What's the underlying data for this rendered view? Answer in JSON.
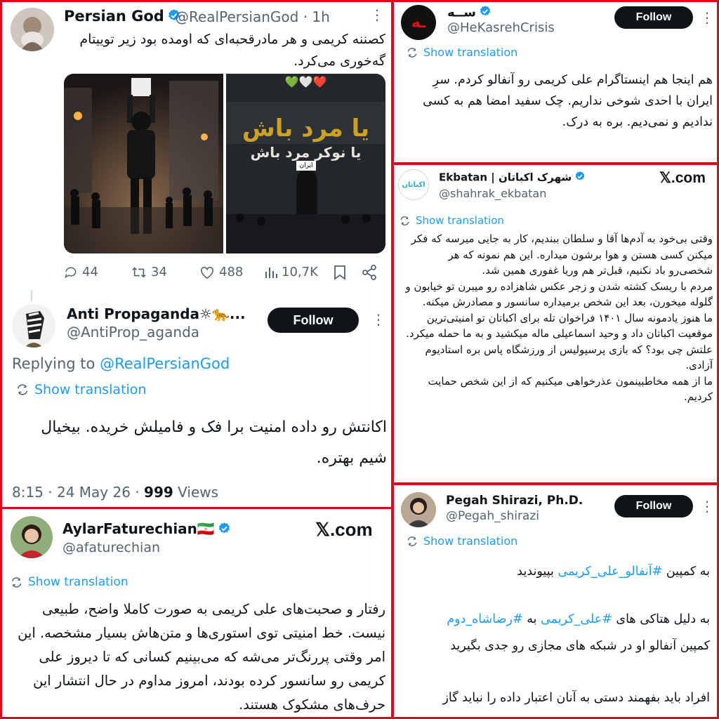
{
  "tweet1": {
    "display_name": "Persian God",
    "handle": "@RealPersianGod",
    "time": "· 1h",
    "text": "کصننه کریمی و هر مادرقحبه‌ای که اومده بود زیر توییتام گه‌خوری می‌کرد.",
    "media2": {
      "emojis": "💚🤍❤️",
      "line1": "یا مرد باش",
      "line2": "یا نوکر مرد باش",
      "sign": "ایران"
    },
    "stats": {
      "replies": "44",
      "retweets": "34",
      "likes": "488",
      "views": "10,7K"
    }
  },
  "reply": {
    "display_name": "Anti Propaganda☼🐆...",
    "handle": "@AntiProp_aganda",
    "follow": "Follow",
    "replying_prefix": "Replying to",
    "replying_to": "@RealPersianGod",
    "show_translation": "Show translation",
    "text": "اکانتش رو داده امنیت برا فک و فامیلش خریده. بیخیال شیم بهتره.",
    "meta_prefix": "8:15 · 24 May 26 ·",
    "views_count": "999",
    "views_label": "Views"
  },
  "tweet2": {
    "display_name": "ســه",
    "avatar_text": "ـه",
    "handle": "@HeKasrehCrisis",
    "follow": "Follow",
    "show_translation": "Show translation",
    "text": "هم اینجا هم اینستاگرام علی کریمی رو آنفالو کردم. سرِ ایران با احدی شوخی نداریم. چک سفید امضا هم به کسی ندادیم و نمی‌دیم. بره به درک."
  },
  "tweet3": {
    "display_name": "Ekbatan | شهرک اکباتان",
    "handle": "@shahrak_ekbatan",
    "avatar_text": "اکباتان",
    "xcom": "𝕏.com",
    "show_translation": "Show translation",
    "paragraphs": [
      "وقتی بی‌خود به آدم‌ها آقا و سلطان ببندیم، کار به جایی میرسه که فکر میکنن کسی هستن و هوا برشون میداره. این هم نمونه که هر شخصی‌رو باد نکنیم، قبل‌تر هم وریا غفوری همین شد.",
      "مردم با ریسک کشته شدن و زجر عکس شاهزاده رو میبرن تو خیابون و گلوله میخورن، بعد این شخص برمیداره سانسور و مصادرش میکنه.",
      "ما هنوز یادمونه سال ۱۴۰۱ فراخوان تله برای اکباتان تو امنیتی‌ترین موقعیت اکباتان داد و وحید اسماعیلی ماله میکشید و به ما حمله میکرد. علتش چی بود؟ که بازی پرسپولیس از ورزشگاه پاس بره استادیوم آزادی.",
      "ما از همه مخاطبینمون عذرخواهی میکنیم که از این شخص حمایت کردیم."
    ]
  },
  "tweet4": {
    "display_name": "AylarFaturechian🇮🇷",
    "handle": "@afaturechian",
    "xcom": "𝕏.com",
    "show_translation": "Show translation",
    "text": "رفتار و صحبت‌های علی کریمی به صورت کاملا واضح، طبیعی نیست. خط امنیتی توی استوری‌ها و متن‌هاش بسیار مشخصه. این امر وقتی پررنگ‌تر می‌شه که می‌بینیم کسانی که تا دیروز علی کریمی رو سانسور کرده بودند، امروز مداوم در حال انتشار این حرف‌های مشکوک هستند."
  },
  "tweet5": {
    "display_name": "Pegah Shirazi, Ph.D.",
    "handle": "@Pegah_shirazi",
    "follow": "Follow",
    "show_translation": "Show translation",
    "l1_pre": "به کمپین ",
    "l1_tag": "#آنفالو_علی_کریمی",
    "l1_post": " بپیوندید",
    "l2_pre": "به دلیل هتاکی های ",
    "l2_tag1": "#علی_کریمی",
    "l2_mid": " به ",
    "l2_tag2": "#رضاشاه_دوم",
    "l3": "کمپین آنفالو او در شبکه های مجازی رو جدی بگیرید",
    "l4": "افراد باید بفهمند دستی به آنان اعتبار داده را نباید گاز"
  },
  "colors": {
    "frame": "#e0001b",
    "link": "#1d9bf0",
    "verified": "#1d9bf0",
    "muted": "#536471"
  }
}
